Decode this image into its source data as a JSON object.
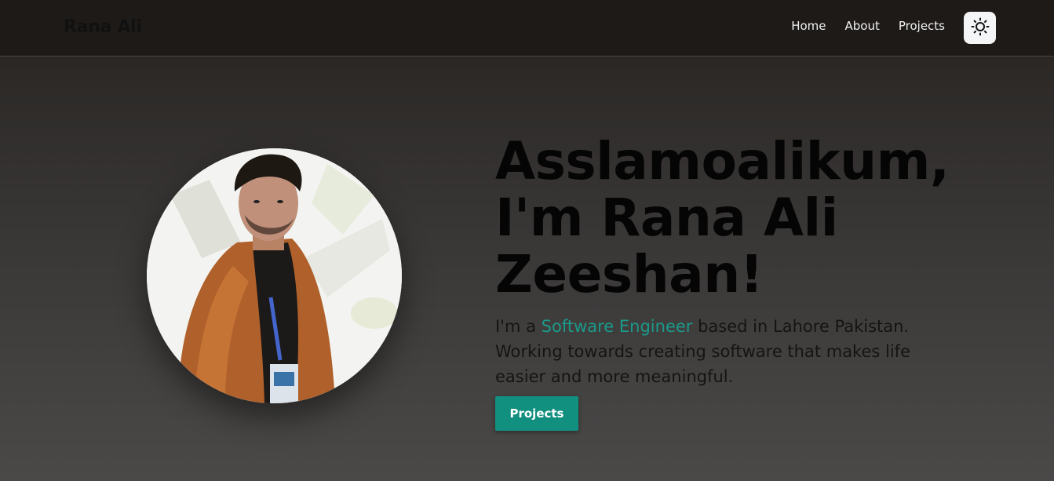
{
  "navbar": {
    "brand": "Rana Ali",
    "links": [
      {
        "label": "Home"
      },
      {
        "label": "About"
      },
      {
        "label": "Projects"
      }
    ],
    "theme_toggle_icon": "sun-icon"
  },
  "hero": {
    "title_line1": "Asslamoalikum,",
    "title_line2": "I'm Rana Ali",
    "title_line3": "Zeeshan!",
    "desc_prefix": "I'm a ",
    "desc_highlight": "Software Engineer",
    "desc_suffix": " based in Lahore Pakistan. Working towards creating software that makes life easier and more meaningful.",
    "button_label": "Projects",
    "avatar_icon": "profile-photo"
  },
  "colors": {
    "accent": "#11907f",
    "highlight_text": "#1a9a8a",
    "navbar_bg": "#1d1a18"
  }
}
